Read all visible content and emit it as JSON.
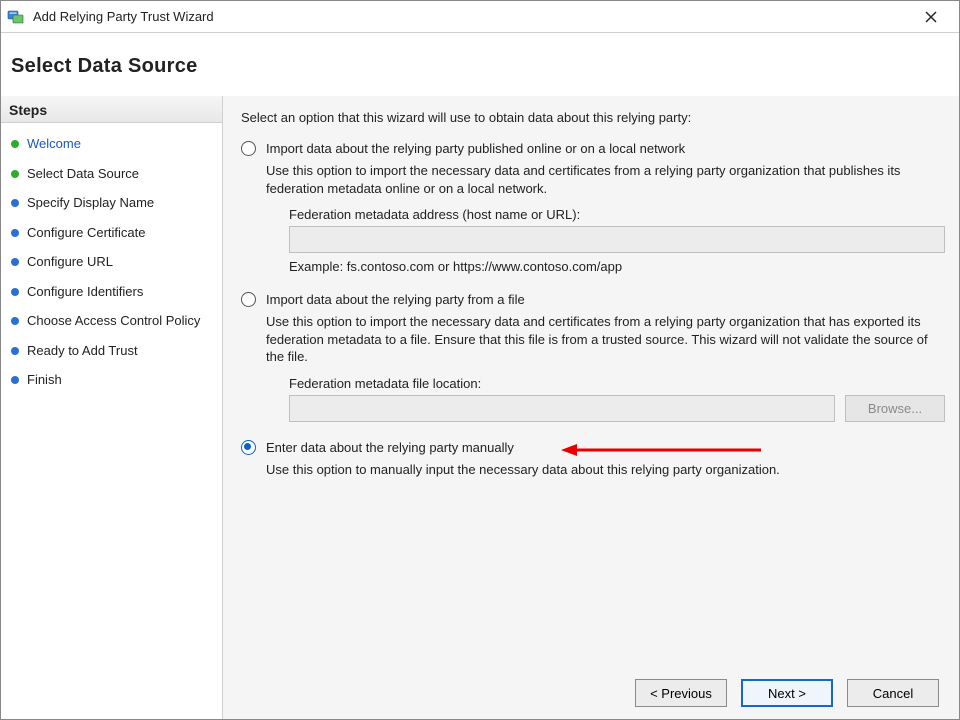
{
  "titlebar": {
    "title": "Add Relying Party Trust Wizard"
  },
  "page_title": "Select Data Source",
  "steps_header": "Steps",
  "steps": [
    {
      "label": "Welcome",
      "dot": "green",
      "color": "blue"
    },
    {
      "label": "Select Data Source",
      "dot": "green",
      "color": "black"
    },
    {
      "label": "Specify Display Name",
      "dot": "blue",
      "color": "black"
    },
    {
      "label": "Configure Certificate",
      "dot": "blue",
      "color": "black"
    },
    {
      "label": "Configure URL",
      "dot": "blue",
      "color": "black"
    },
    {
      "label": "Configure Identifiers",
      "dot": "blue",
      "color": "black"
    },
    {
      "label": "Choose Access Control Policy",
      "dot": "blue",
      "color": "black"
    },
    {
      "label": "Ready to Add Trust",
      "dot": "blue",
      "color": "black"
    },
    {
      "label": "Finish",
      "dot": "blue",
      "color": "black"
    }
  ],
  "content": {
    "intro": "Select an option that this wizard will use to obtain data about this relying party:",
    "opt_online": {
      "label": "Import data about the relying party published online or on a local network",
      "desc": "Use this option to import the necessary data and certificates from a relying party organization that publishes its federation metadata online or on a local network.",
      "field_label": "Federation metadata address (host name or URL):",
      "field_value": "",
      "example": "Example: fs.contoso.com or https://www.contoso.com/app"
    },
    "opt_file": {
      "label": "Import data about the relying party from a file",
      "desc": "Use this option to import the necessary data and certificates from a relying party organization that has exported its federation metadata to a file. Ensure that this file is from a trusted source.  This wizard will not validate the source of the file.",
      "field_label": "Federation metadata file location:",
      "field_value": "",
      "browse_label": "Browse..."
    },
    "opt_manual": {
      "label": "Enter data about the relying party manually",
      "desc": "Use this option to manually input the necessary data about this relying party organization."
    }
  },
  "buttons": {
    "previous": "< Previous",
    "next": "Next >",
    "cancel": "Cancel"
  }
}
